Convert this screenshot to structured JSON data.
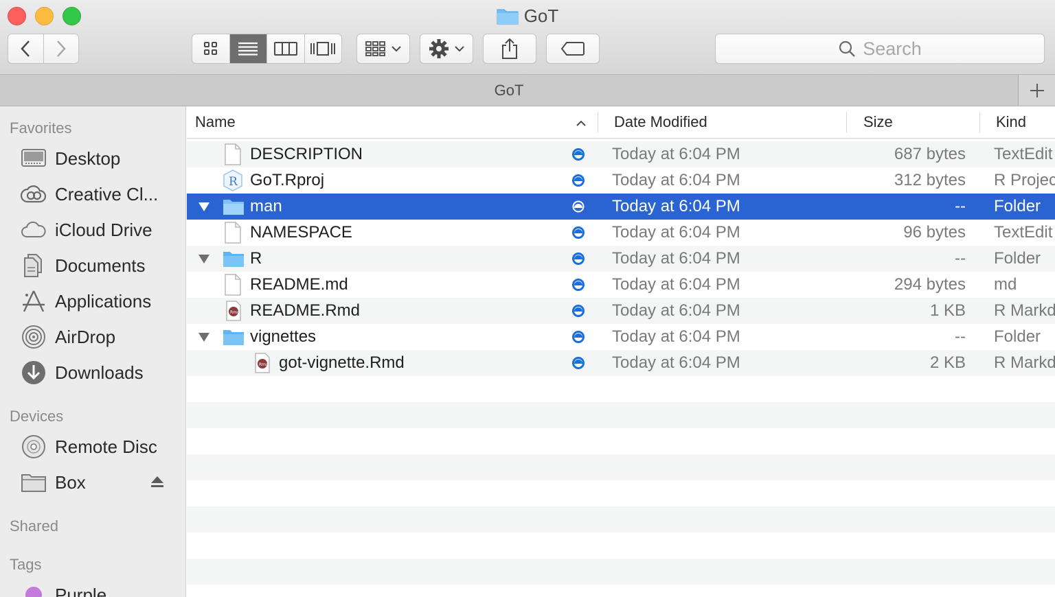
{
  "window": {
    "title": "GoT"
  },
  "toolbar": {
    "view_modes": [
      "icon-view",
      "list-view",
      "column-view",
      "cover-flow-view"
    ],
    "active_view": "list-view",
    "search_placeholder": "Search"
  },
  "tabbar": {
    "title": "GoT"
  },
  "sidebar": {
    "favorites_header": "Favorites",
    "favorites": [
      {
        "label": "Desktop",
        "icon": "desktop-icon"
      },
      {
        "label": "Creative Cl...",
        "icon": "creative-cloud-icon"
      },
      {
        "label": "iCloud Drive",
        "icon": "cloud-icon"
      },
      {
        "label": "Documents",
        "icon": "documents-icon"
      },
      {
        "label": "Applications",
        "icon": "applications-icon"
      },
      {
        "label": "AirDrop",
        "icon": "airdrop-icon"
      },
      {
        "label": "Downloads",
        "icon": "downloads-icon"
      }
    ],
    "devices_header": "Devices",
    "devices": [
      {
        "label": "Remote Disc",
        "icon": "disc-icon"
      },
      {
        "label": "Box",
        "icon": "folder-icon"
      }
    ],
    "shared_header": "Shared",
    "tags_header": "Tags",
    "tags": [
      {
        "label": "Purple",
        "color": "#c27bdb"
      }
    ]
  },
  "columns": {
    "name": "Name",
    "date": "Date Modified",
    "size": "Size",
    "kind": "Kind"
  },
  "files": [
    {
      "name": "DESCRIPTION",
      "date": "Today at 6:04 PM",
      "size": "687 bytes",
      "kind": "TextEdit",
      "icon": "document-icon",
      "indent": 0,
      "expandable": false
    },
    {
      "name": "GoT.Rproj",
      "date": "Today at 6:04 PM",
      "size": "312 bytes",
      "kind": "R Project",
      "icon": "rproj-icon",
      "indent": 0,
      "expandable": false
    },
    {
      "name": "man",
      "date": "Today at 6:04 PM",
      "size": "--",
      "kind": "Folder",
      "icon": "folder-icon",
      "indent": 0,
      "expandable": true,
      "selected": true
    },
    {
      "name": "NAMESPACE",
      "date": "Today at 6:04 PM",
      "size": "96 bytes",
      "kind": "TextEdit",
      "icon": "document-icon",
      "indent": 0,
      "expandable": false
    },
    {
      "name": "R",
      "date": "Today at 6:04 PM",
      "size": "--",
      "kind": "Folder",
      "icon": "folder-icon",
      "indent": 0,
      "expandable": true
    },
    {
      "name": "README.md",
      "date": "Today at 6:04 PM",
      "size": "294 bytes",
      "kind": "md",
      "icon": "document-icon",
      "indent": 0,
      "expandable": false
    },
    {
      "name": "README.Rmd",
      "date": "Today at 6:04 PM",
      "size": "1 KB",
      "kind": "R Markdown",
      "icon": "rmd-icon",
      "indent": 0,
      "expandable": false
    },
    {
      "name": "vignettes",
      "date": "Today at 6:04 PM",
      "size": "--",
      "kind": "Folder",
      "icon": "folder-icon",
      "indent": 0,
      "expandable": true
    },
    {
      "name": "got-vignette.Rmd",
      "date": "Today at 6:04 PM",
      "size": "2 KB",
      "kind": "R Markdown",
      "icon": "rmd-icon",
      "indent": 1,
      "expandable": false
    }
  ],
  "colors": {
    "selection": "#2a64d2",
    "sync_status": "#1a6fe0",
    "folder": "#5fb4f2"
  }
}
